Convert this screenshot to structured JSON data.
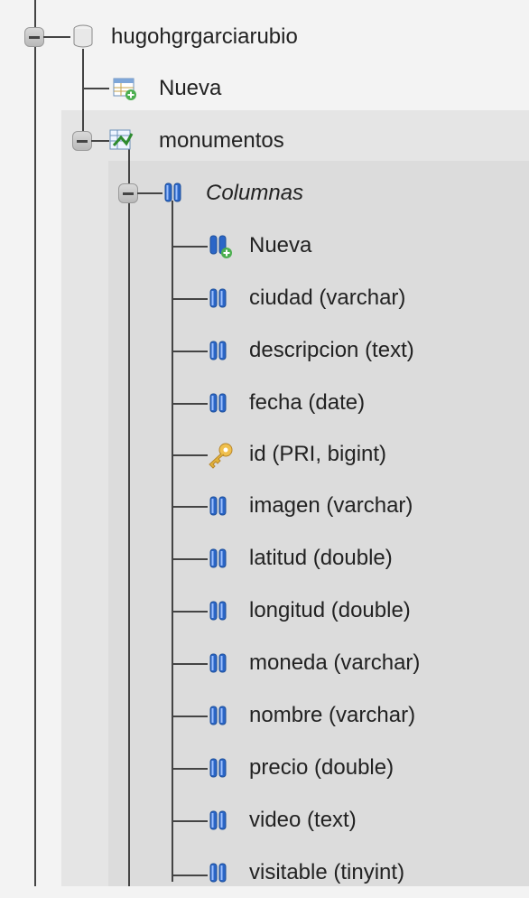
{
  "tree": {
    "database": {
      "label": "hugohgrgarciarubio",
      "icon": "database-icon",
      "toggle": "collapse"
    },
    "db_new": {
      "label": "Nueva",
      "icon": "new-table-icon"
    },
    "table": {
      "label": "monumentos",
      "icon": "table-icon",
      "toggle": "collapse"
    },
    "columns_group": {
      "label": "Columnas",
      "icon": "columns-icon",
      "toggle": "collapse"
    },
    "columns": [
      {
        "label": "Nueva",
        "icon": "new-column-icon"
      },
      {
        "label": "ciudad (varchar)",
        "icon": "column-icon"
      },
      {
        "label": "descripcion (text)",
        "icon": "column-icon"
      },
      {
        "label": "fecha (date)",
        "icon": "column-icon"
      },
      {
        "label": "id (PRI, bigint)",
        "icon": "key-icon"
      },
      {
        "label": "imagen (varchar)",
        "icon": "column-icon"
      },
      {
        "label": "latitud (double)",
        "icon": "column-icon"
      },
      {
        "label": "longitud (double)",
        "icon": "column-icon"
      },
      {
        "label": "moneda (varchar)",
        "icon": "column-icon"
      },
      {
        "label": "nombre (varchar)",
        "icon": "column-icon"
      },
      {
        "label": "precio (double)",
        "icon": "column-icon"
      },
      {
        "label": "video (text)",
        "icon": "column-icon"
      },
      {
        "label": "visitable (tinyint)",
        "icon": "column-icon"
      }
    ]
  },
  "colors": {
    "line": "#444444",
    "panel": "#e5e5e5",
    "panel_inner": "#dcdcdc",
    "column_blue": "#2b66c7",
    "key_gold": "#e3b43a",
    "new_green": "#4caf50"
  }
}
